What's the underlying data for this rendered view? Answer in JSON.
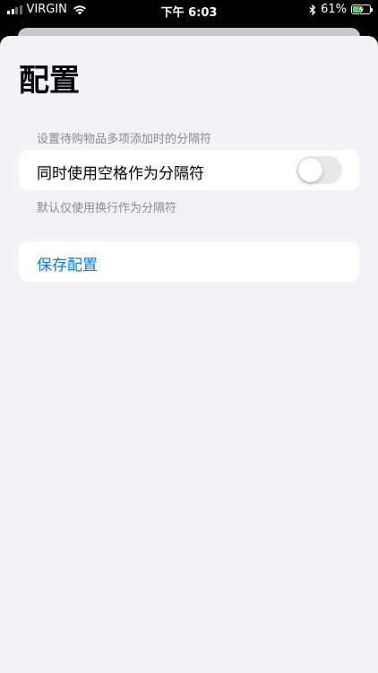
{
  "status_bar": {
    "carrier": "VIRGIN",
    "time": "下午 6:03",
    "battery_percent": "61%",
    "battery_level": 0.61,
    "charging": true
  },
  "page": {
    "title": "配置"
  },
  "separator_section": {
    "header": "设置待购物品多项添加时的分隔符",
    "toggle_label": "同时使用空格作为分隔符",
    "toggle_on": false,
    "footer": "默认仅使用换行作为分隔符"
  },
  "actions": {
    "save_label": "保存配置"
  },
  "colors": {
    "accent": "#007aff",
    "background": "#f2f2f7",
    "toggle_off": "#e9e9eb",
    "secondary_text": "#8a8a8e"
  }
}
